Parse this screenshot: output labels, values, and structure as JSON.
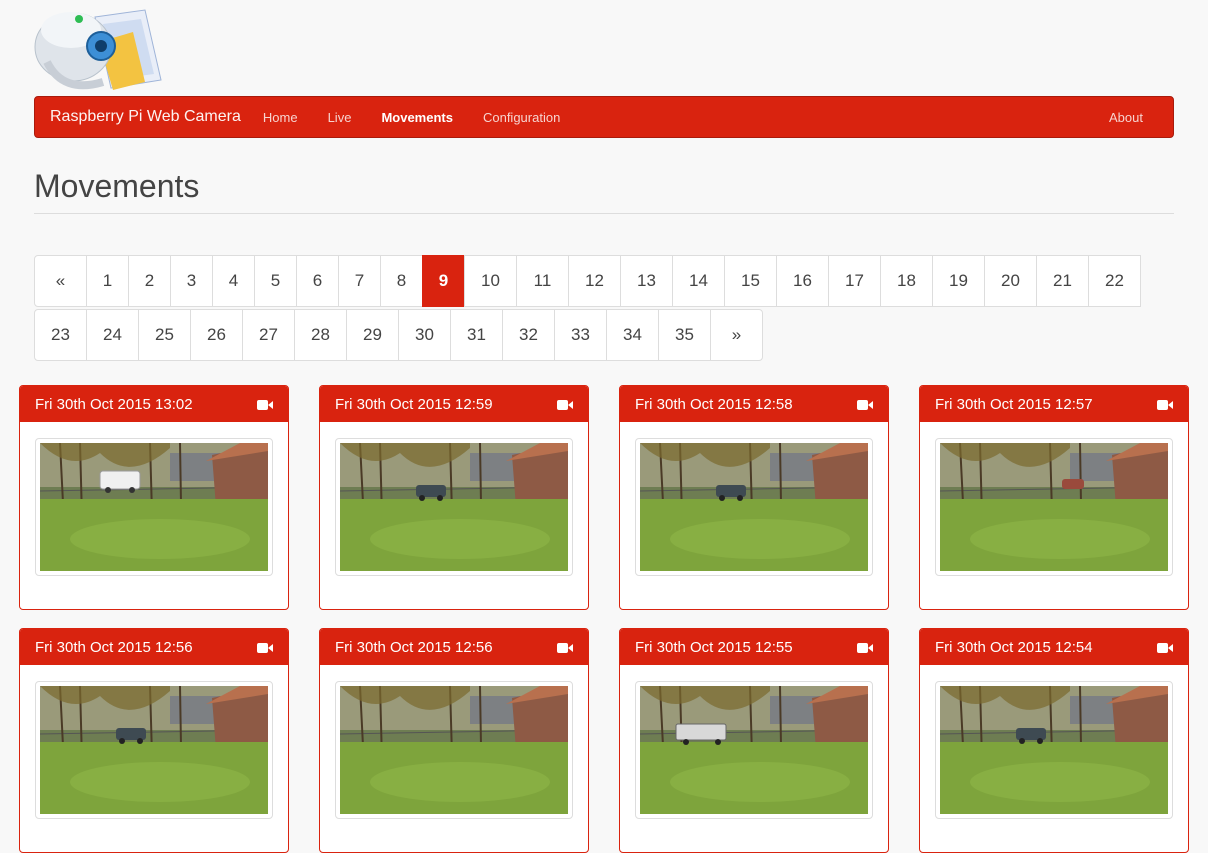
{
  "navbar": {
    "brand": "Raspberry Pi Web Camera",
    "items": [
      {
        "label": "Home",
        "active": false
      },
      {
        "label": "Live",
        "active": false
      },
      {
        "label": "Movements",
        "active": true
      },
      {
        "label": "Configuration",
        "active": false
      }
    ],
    "right_item": "About"
  },
  "page": {
    "title": "Movements"
  },
  "pagination": {
    "prev": "«",
    "next": "»",
    "current": "9",
    "row1": [
      "1",
      "2",
      "3",
      "4",
      "5",
      "6",
      "7",
      "8",
      "9",
      "10",
      "11",
      "12",
      "13",
      "14",
      "15",
      "16",
      "17",
      "18",
      "19",
      "20",
      "21",
      "22"
    ],
    "row2": [
      "23",
      "24",
      "25",
      "26",
      "27",
      "28",
      "29",
      "30",
      "31",
      "32",
      "33",
      "34",
      "35"
    ]
  },
  "cards": [
    {
      "timestamp": "Fri 30th Oct 2015 13:02",
      "icon": "video-camera-icon",
      "vehicle": "white-van"
    },
    {
      "timestamp": "Fri 30th Oct 2015 12:59",
      "icon": "video-camera-icon",
      "vehicle": "dark-car"
    },
    {
      "timestamp": "Fri 30th Oct 2015 12:58",
      "icon": "video-camera-icon",
      "vehicle": "dark-car"
    },
    {
      "timestamp": "Fri 30th Oct 2015 12:57",
      "icon": "video-camera-icon",
      "vehicle": "red-car"
    },
    {
      "timestamp": "Fri 30th Oct 2015 12:56",
      "icon": "video-camera-icon",
      "vehicle": "dark-car"
    },
    {
      "timestamp": "Fri 30th Oct 2015 12:56",
      "icon": "video-camera-icon",
      "vehicle": "none"
    },
    {
      "timestamp": "Fri 30th Oct 2015 12:55",
      "icon": "video-camera-icon",
      "vehicle": "truck"
    },
    {
      "timestamp": "Fri 30th Oct 2015 12:54",
      "icon": "video-camera-icon",
      "vehicle": "dark-car"
    }
  ],
  "colors": {
    "accent": "#d9230f",
    "background": "#f8f8f8"
  }
}
